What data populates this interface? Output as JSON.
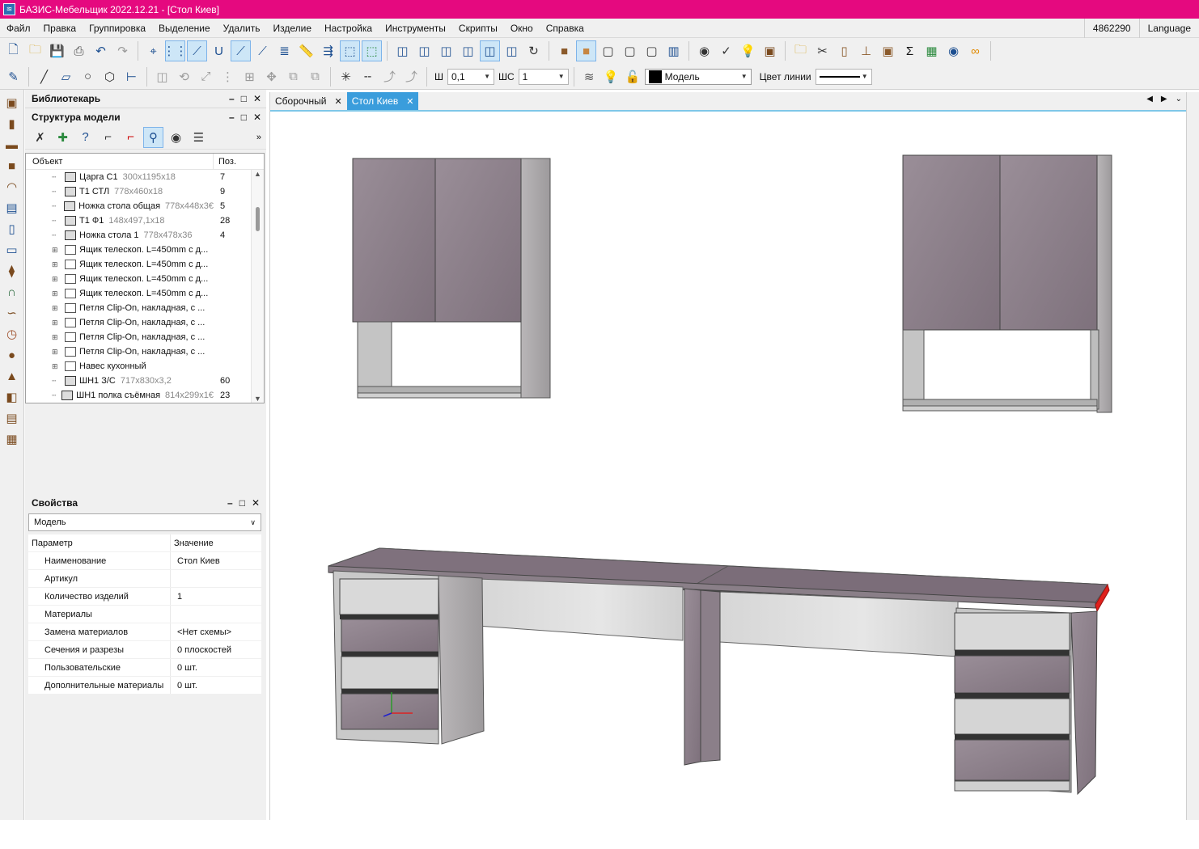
{
  "window": {
    "title": "БАЗИС-Мебельщик 2022.12.21 - [Стол Киев]"
  },
  "menu": {
    "items": [
      "Файл",
      "Правка",
      "Группировка",
      "Выделение",
      "Удалить",
      "Изделие",
      "Настройка",
      "Инструменты",
      "Скрипты",
      "Окно",
      "Справка"
    ],
    "right_number": "4862290",
    "language": "Language"
  },
  "toolbar2": {
    "w_label": "Ш",
    "w_value": "0,1",
    "ws_label": "ШС",
    "ws_value": "1",
    "layer_value": "Модель",
    "line_color_label": "Цвет линии"
  },
  "librarian": {
    "title": "Библиотекарь"
  },
  "model_structure": {
    "title": "Структура модели",
    "col_object": "Объект",
    "col_pos": "Поз.",
    "rows": [
      {
        "name": "Царга С1",
        "dims": "300x1195x18",
        "pos": "7",
        "group": false
      },
      {
        "name": "Т1 СТЛ",
        "dims": "778x460x18",
        "pos": "9",
        "group": false
      },
      {
        "name": "Ножка стола общая",
        "dims": "778x448x3€",
        "pos": "5",
        "group": false
      },
      {
        "name": "Т1 Ф1",
        "dims": "148x497,1x18",
        "pos": "28",
        "group": false
      },
      {
        "name": "Ножка стола 1",
        "dims": "778x478x36",
        "pos": "4",
        "group": false
      },
      {
        "name": "Ящик телескоп. L=450mm с д...",
        "dims": "",
        "pos": "",
        "group": true
      },
      {
        "name": "Ящик телескоп. L=450mm с д...",
        "dims": "",
        "pos": "",
        "group": true
      },
      {
        "name": "Ящик телескоп. L=450mm с д...",
        "dims": "",
        "pos": "",
        "group": true
      },
      {
        "name": "Ящик телескоп. L=450mm с д...",
        "dims": "",
        "pos": "",
        "group": true
      },
      {
        "name": "Петля Clip-On, накладная, с ...",
        "dims": "",
        "pos": "",
        "group": true
      },
      {
        "name": "Петля Clip-On, накладная, с ...",
        "dims": "",
        "pos": "",
        "group": true
      },
      {
        "name": "Петля Clip-On, накладная, с ...",
        "dims": "",
        "pos": "",
        "group": true
      },
      {
        "name": "Петля Clip-On, накладная, с ...",
        "dims": "",
        "pos": "",
        "group": true
      },
      {
        "name": "Навес кухонный",
        "dims": "",
        "pos": "",
        "group": true
      },
      {
        "name": "ШН1 З/С",
        "dims": "717x830x3,2",
        "pos": "60",
        "group": false
      },
      {
        "name": "ШН1 полка съёмная",
        "dims": "814x299x1€",
        "pos": "23",
        "group": false
      }
    ]
  },
  "properties": {
    "title": "Свойства",
    "combo_value": "Модель",
    "col_param": "Параметр",
    "col_value": "Значение",
    "rows": [
      {
        "k": "Наименование",
        "v": "Стол Киев"
      },
      {
        "k": "Артикул",
        "v": ""
      },
      {
        "k": "Количество изделий",
        "v": "1"
      },
      {
        "k": "Материалы",
        "v": ""
      },
      {
        "k": "Замена материалов",
        "v": "<Нет схемы>"
      },
      {
        "k": "Сечения и разрезы",
        "v": "0 плоскостей"
      },
      {
        "k": "Пользовательские",
        "v": "0 шт."
      },
      {
        "k": "Дополнительные материалы",
        "v": "0 шт."
      }
    ]
  },
  "tabs": [
    {
      "label": "Сборочный",
      "active": false
    },
    {
      "label": "Стол Киев",
      "active": true
    }
  ],
  "colors": {
    "titlebar": "#e5097f",
    "panel_fabric": "#8d7f8a",
    "carcass_light": "#c9c9c9",
    "edge_highlight": "#e0201c"
  }
}
